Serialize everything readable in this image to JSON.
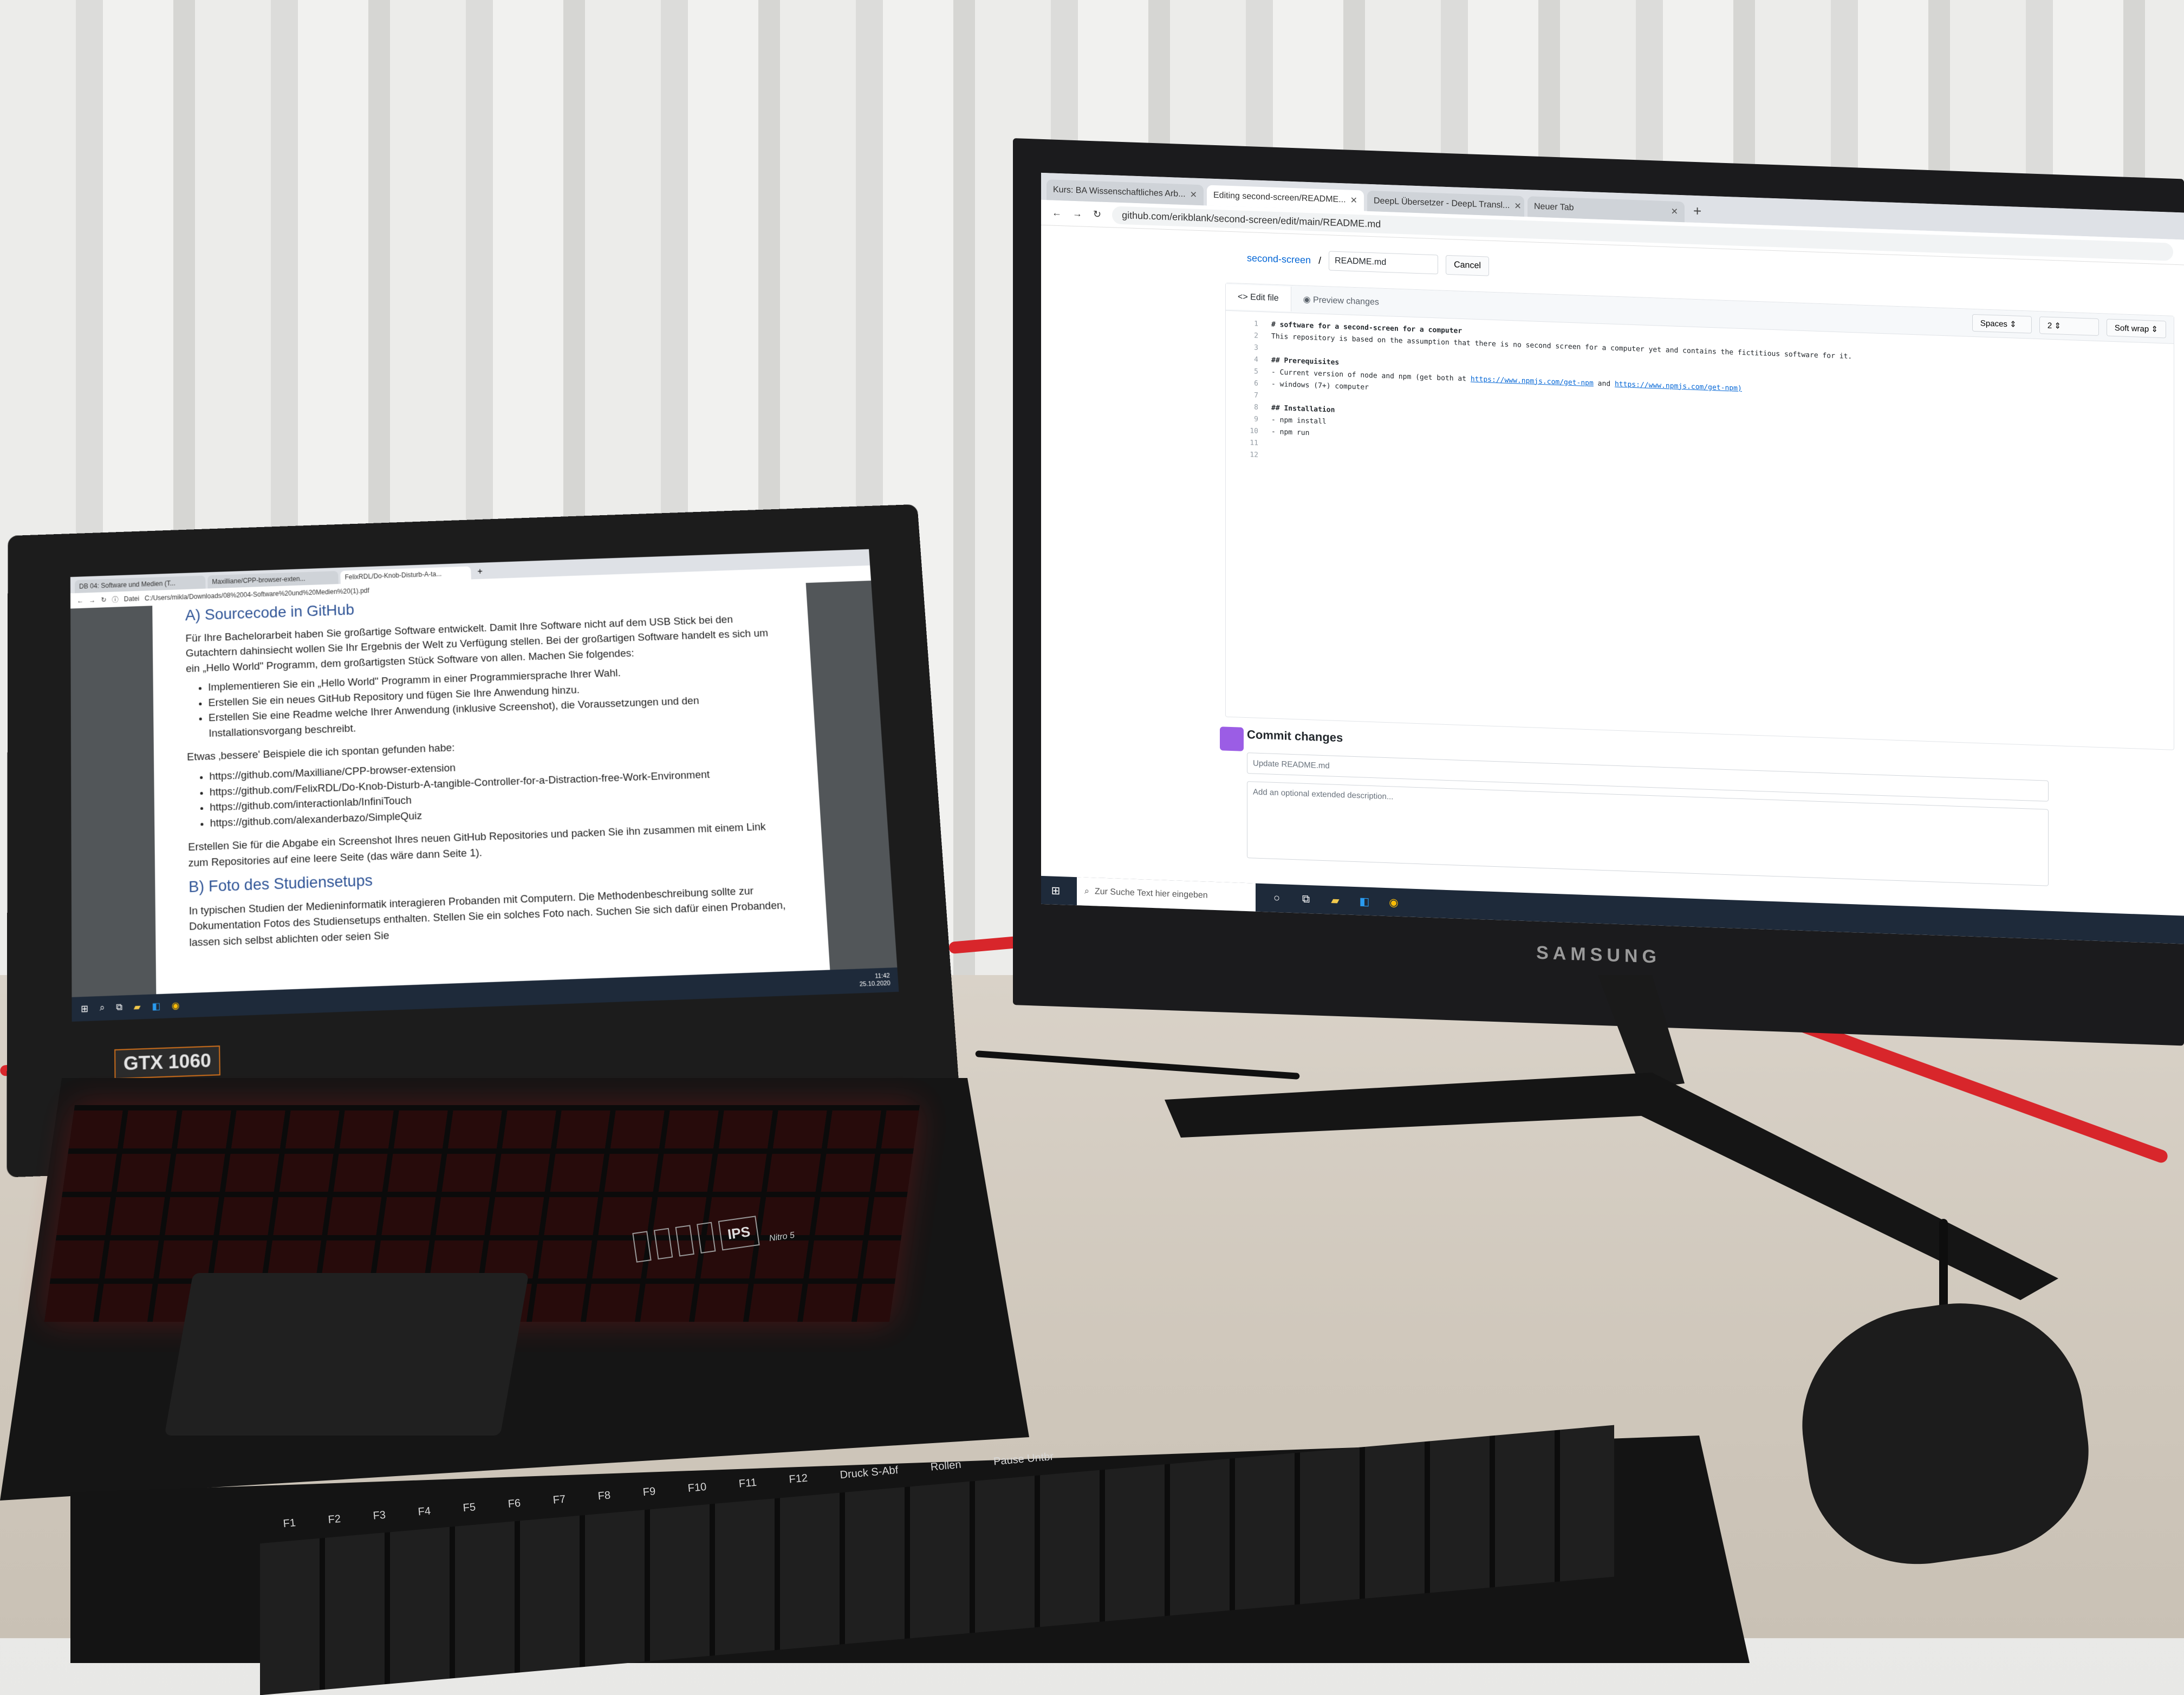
{
  "monitor": {
    "brand": "SAMSUNG",
    "tabs": [
      {
        "label": "Kurs: BA Wissenschaftliches Arb...",
        "active": false
      },
      {
        "label": "Editing second-screen/README...",
        "active": true
      },
      {
        "label": "DeepL Übersetzer - DeepL Transl...",
        "active": false
      },
      {
        "label": "Neuer Tab",
        "active": false
      }
    ],
    "url": "github.com/erikblank/second-screen/edit/main/README.md",
    "breadcrumb_repo": "second-screen",
    "breadcrumb_sep": "/",
    "filename": "README.md",
    "cancel_label": "Cancel",
    "edit_tab": "Edit file",
    "preview_tab": "Preview changes",
    "indent_mode": "Spaces",
    "indent_size": "2",
    "wrap_mode": "Soft wrap",
    "code_lines": [
      "# software for a second-screen for a computer",
      "This repository is based on the assumption that there is no second screen for a computer yet and contains the fictitious software for it.",
      "",
      "## Prerequisites",
      "- Current version of node and npm (get both at https://www.npmjs.com/get-npm and https://www.npmjs.com/get-npm)",
      "- windows (7+) computer",
      "",
      "## Installation",
      "- npm install",
      "- npm run",
      "",
      ""
    ],
    "commit_heading": "Commit changes",
    "commit_placeholder": "Update README.md",
    "commit_description_placeholder": "Add an optional extended description...",
    "taskbar_search": "Zur Suche Text hier eingeben"
  },
  "laptop": {
    "tabs": [
      {
        "label": "DB 04: Software und Medien (T...",
        "active": false
      },
      {
        "label": "Maxilliane/CPP-browser-exten...",
        "active": false
      },
      {
        "label": "FelixRDL/Do-Knob-Disturb-A-ta...",
        "active": true
      }
    ],
    "address_prefix": "Datei",
    "address": "C:/Users/mikla/Downloads/08%2004-Software%20und%20Medien%20(1).pdf",
    "pdf": {
      "heading_a": "A) Sourcecode in GitHub",
      "intro": "Für Ihre Bachelorarbeit haben Sie großartige Software entwickelt. Damit Ihre Software nicht auf dem USB Stick bei den Gutachtern dahinsiecht wollen Sie Ihr Ergebnis der Welt zu Verfügung stellen. Bei der großartigen Software handelt es sich um ein „Hello World\" Programm, dem großartigsten Stück Software von allen. Machen Sie folgendes:",
      "tasks": [
        "Implementieren Sie ein „Hello World\" Programm in einer Programmiersprache Ihrer Wahl.",
        "Erstellen Sie ein neues GitHub Repository und fügen Sie Ihre Anwendung hinzu.",
        "Erstellen Sie eine Readme welche Ihrer Anwendung (inklusive Screenshot), die Voraussetzungen und den Installationsvorgang beschreibt."
      ],
      "examples_intro": "Etwas ‚bessere' Beispiele die ich spontan gefunden habe:",
      "examples": [
        "https://github.com/Maxilliane/CPP-browser-extension",
        "https://github.com/FelixRDL/Do-Knob-Disturb-A-tangible-Controller-for-a-Distraction-free-Work-Environment",
        "https://github.com/interactionlab/InfiniTouch",
        "https://github.com/alexanderbazo/SimpleQuiz"
      ],
      "submission": "Erstellen Sie für die Abgabe ein Screenshot Ihres neuen GitHub Repositories und packen Sie ihn zusammen mit einem Link zum Repositories auf eine leere Seite (das wäre dann Seite 1).",
      "heading_b": "B) Foto des Studiensetups",
      "b_text": "In typischen Studien der Medieninformatik interagieren Probanden mit Computern. Die Methodenbeschreibung sollte zur Dokumentation Fotos des Studiensetups enthalten. Stellen Sie ein solches Foto nach. Suchen Sie sich dafür einen Probanden, lassen sich selbst ablichten oder seien Sie"
    },
    "clock_time": "11:42",
    "clock_date": "25.10.2020",
    "gpu_badge": "GTX 1060",
    "model": "Nitro 5",
    "stickers": [
      "IPS"
    ]
  },
  "keyboard": {
    "keys": [
      "F1",
      "F2",
      "F3",
      "F4",
      "F5",
      "F6",
      "F7",
      "F8",
      "F9",
      "F10",
      "F11",
      "F12",
      "Druck S-Abf",
      "Rollen",
      "Pause Untbr"
    ]
  },
  "colors": {
    "github_link": "#0366d6",
    "pdf_heading": "#2f5496",
    "cable_red": "#d8262b",
    "keyboard_backlight": "#e02020"
  }
}
